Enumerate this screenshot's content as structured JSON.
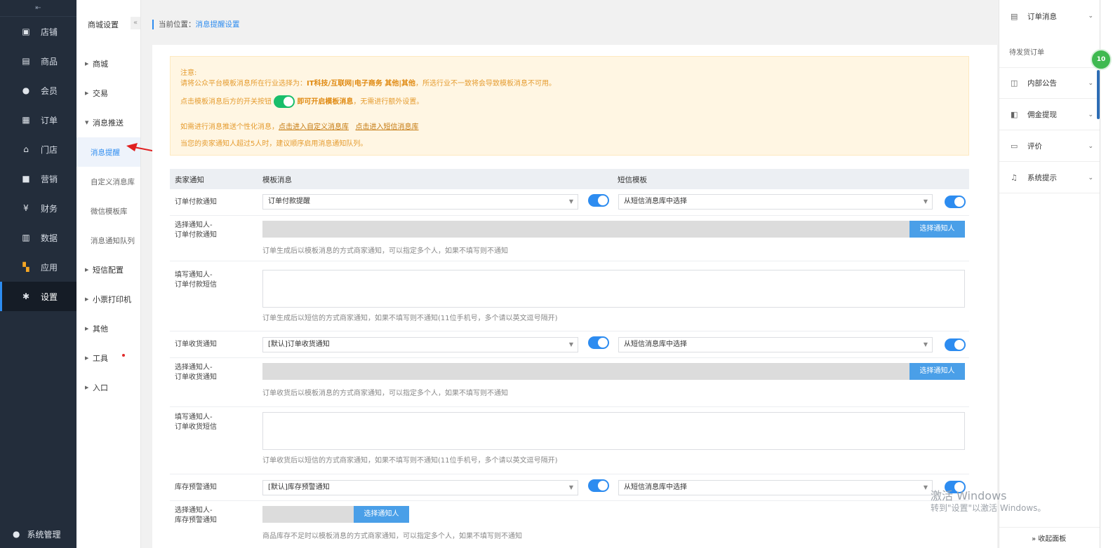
{
  "nav": {
    "collapse_icon": "⇤",
    "items": [
      {
        "label": "店铺",
        "icon": "store-icon"
      },
      {
        "label": "商品",
        "icon": "goods-icon"
      },
      {
        "label": "会员",
        "icon": "member-icon"
      },
      {
        "label": "订单",
        "icon": "order-icon"
      },
      {
        "label": "门店",
        "icon": "shop-icon"
      },
      {
        "label": "营销",
        "icon": "gift-icon"
      },
      {
        "label": "财务",
        "icon": "money-icon"
      },
      {
        "label": "数据",
        "icon": "chart-icon"
      },
      {
        "label": "应用",
        "icon": "apps-icon"
      },
      {
        "label": "设置",
        "icon": "gear-icon"
      }
    ],
    "bottom": "系统管理"
  },
  "subnav": {
    "title": "商城设置",
    "fold": "«",
    "items": [
      "商城",
      "交易",
      "消息推送"
    ],
    "children": [
      "消息提醒",
      "自定义消息库",
      "微信模板库",
      "消息通知队列"
    ],
    "items2": [
      "短信配置",
      "小票打印机",
      "其他",
      "工具",
      "入口"
    ]
  },
  "breadcrumb": {
    "prefix": "当前位置：",
    "current": "消息提醒设置"
  },
  "notice": {
    "l1": "注意:",
    "l2a": "请将公众平台模板消息所在行业选择为：",
    "l2b": "IT科技/互联网|电子商务 其他|其他",
    "l2c": "，所选行业不一致将会导致模板消息不可用。",
    "l3a": "点击模板消息后方的开关按钮",
    "l3b": "即可开启模板消息",
    "l3c": "，无需进行额外设置。",
    "l4a": "如需进行消息推送个性化消息，",
    "l4b": "点击进入自定义消息库",
    "l4c": "点击进入短信消息库",
    "l5": "当您的卖家通知人超过5人时，建议顺序启用消息通知队列。"
  },
  "table": {
    "col1": "卖家通知",
    "col2": "模板消息",
    "col3": "短信模板"
  },
  "rows": {
    "r1": {
      "label": "订单付款通知",
      "tpl": "订单付款提醒",
      "sms": "从短信消息库中选择",
      "notifier_label_1": "选择通知人-",
      "notifier_label_2": "订单付款通知",
      "btn": "选择通知人",
      "hint1": "订单生成后以模板消息的方式商家通知，可以指定多个人，如果不填写则不通知",
      "fill_label_1": "填写通知人-",
      "fill_label_2": "订单付款短信",
      "hint2": "订单生成后以短信的方式商家通知，如果不填写则不通知(11位手机号，多个请以英文逗号隔开)"
    },
    "r2": {
      "label": "订单收货通知",
      "tpl": "[默认]订单收货通知",
      "sms": "从短信消息库中选择",
      "notifier_label_1": "选择通知人-",
      "notifier_label_2": "订单收货通知",
      "btn": "选择通知人",
      "hint1": "订单收货后以模板消息的方式商家通知，可以指定多个人，如果不填写则不通知",
      "fill_label_1": "填写通知人-",
      "fill_label_2": "订单收货短信",
      "hint2": "订单收货后以短信的方式商家通知，如果不填写则不通知(11位手机号，多个请以英文逗号隔开)"
    },
    "r3": {
      "label": "库存预警通知",
      "tpl": "[默认]库存预警通知",
      "sms": "从短信消息库中选择",
      "notifier_label_1": "选择通知人-",
      "notifier_label_2": "库存预警通知",
      "btn": "选择通知人",
      "hint1": "商品库存不足时以模板消息的方式商家通知，可以指定多个人，如果不填写则不通知"
    }
  },
  "right": {
    "i1": "订单消息",
    "i1sub": "待发货订单",
    "i2": "内部公告",
    "i3": "佣金提现",
    "i4": "评价",
    "i5": "系统提示",
    "foot": "» 收起面板",
    "badge": "10"
  },
  "watermark": {
    "l1": "激活 Windows",
    "l2": "转到\"设置\"以激活 Windows。"
  }
}
